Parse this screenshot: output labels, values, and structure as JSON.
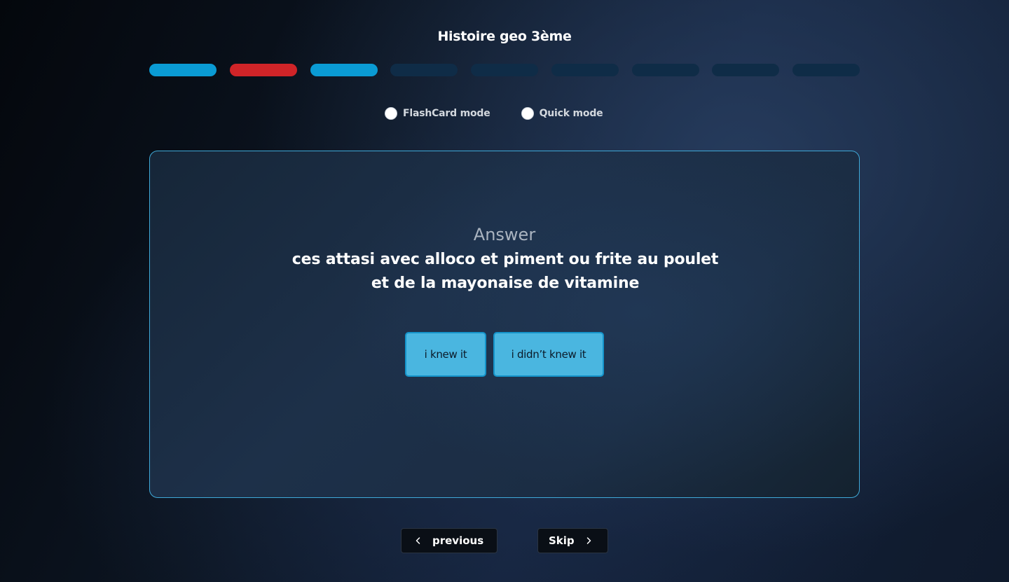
{
  "header": {
    "title": "Histoire geo 3ème"
  },
  "progress": {
    "segments": [
      "correct",
      "wrong",
      "correct",
      "pending",
      "pending",
      "pending",
      "pending",
      "pending",
      "pending"
    ],
    "colors": {
      "correct": "#0a9bd4",
      "wrong": "#d02428",
      "pending": "#0f2c47"
    }
  },
  "modes": {
    "flashcard_label": "FlashCard mode",
    "quick_label": "Quick mode"
  },
  "card": {
    "answer_label": "Answer",
    "answer_text": "ces attasi avec alloco et piment  ou frite au poulet et de la mayonaise de vitamine",
    "knew_label": "i knew it",
    "didnt_label": "i didn’t knew it"
  },
  "nav": {
    "previous_label": "previous",
    "previous_icon": "chevron-left-icon",
    "skip_label": "Skip",
    "skip_icon": "chevron-right-icon"
  },
  "colors": {
    "accent": "#4ab6e0",
    "card_border": "#3fa9d8"
  }
}
